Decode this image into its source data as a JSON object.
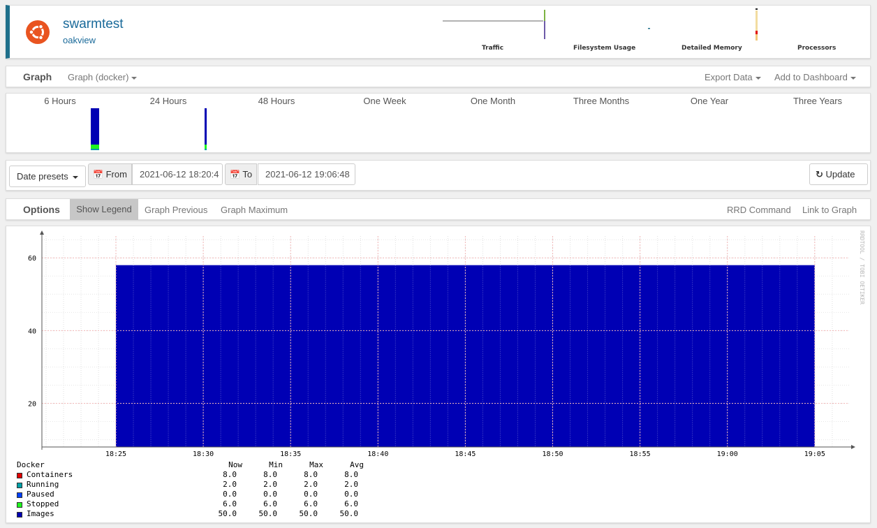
{
  "header": {
    "title": "swarmtest",
    "location": "oakview",
    "mini_graphs": [
      "Traffic",
      "Filesystem Usage",
      "Detailed Memory",
      "Processors"
    ]
  },
  "graph_bar": {
    "title": "Graph",
    "type_dropdown": "Graph (docker)",
    "export": "Export Data",
    "add_dashboard": "Add to Dashboard"
  },
  "timeframes": [
    "6 Hours",
    "24 Hours",
    "48 Hours",
    "One Week",
    "One Month",
    "Three Months",
    "One Year",
    "Three Years"
  ],
  "date_row": {
    "presets": "Date presets",
    "from_label": "From",
    "from_value": "2021-06-12 18:20:4",
    "to_label": "To",
    "to_value": "2021-06-12 19:06:48",
    "update": "Update"
  },
  "options_bar": {
    "title": "Options",
    "show_legend": "Show Legend",
    "graph_previous": "Graph Previous",
    "graph_maximum": "Graph Maximum",
    "rrd_command": "RRD Command",
    "link_to_graph": "Link to Graph"
  },
  "chart_data": {
    "type": "area",
    "watermark": "RRDTOOL / TOBI OETIKER",
    "x_ticks": [
      "18:25",
      "18:30",
      "18:35",
      "18:40",
      "18:45",
      "18:50",
      "18:55",
      "19:00",
      "19:05"
    ],
    "y_ticks": [
      20,
      40,
      60
    ],
    "ylim": [
      8,
      66
    ],
    "legend_title": "Docker",
    "legend_columns": [
      "Now",
      "Min",
      "Max",
      "Avg"
    ],
    "series": [
      {
        "name": "Containers",
        "color": "#e00000",
        "values": [
          "8.0",
          "8.0",
          "8.0",
          "8.0"
        ]
      },
      {
        "name": "Running",
        "color": "#00a0a8",
        "values": [
          "2.0",
          "2.0",
          "2.0",
          "2.0"
        ]
      },
      {
        "name": "Paused",
        "color": "#0040ff",
        "values": [
          "0.0",
          "0.0",
          "0.0",
          "0.0"
        ]
      },
      {
        "name": "Stopped",
        "color": "#1ef51e",
        "values": [
          "6.0",
          "6.0",
          "6.0",
          "6.0"
        ]
      },
      {
        "name": "Images",
        "color": "#0000b4",
        "values": [
          "50.0",
          "50.0",
          "50.0",
          "50.0"
        ]
      }
    ]
  }
}
